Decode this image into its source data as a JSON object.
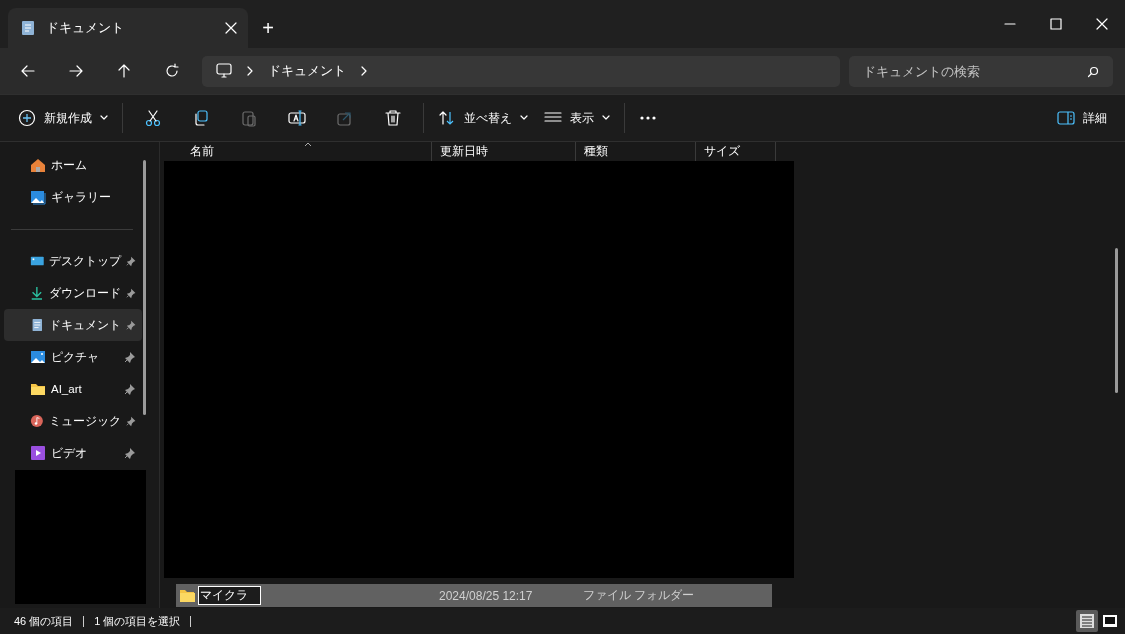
{
  "window": {
    "tabs": [
      {
        "title": "ドキュメント",
        "selected": true
      }
    ],
    "new_tab": "+"
  },
  "navigation": {
    "breadcrumb": [
      "ドキュメント"
    ],
    "search": {
      "placeholder": "ドキュメントの検索"
    }
  },
  "toolbar": {
    "new": "新規作成",
    "icon_buttons": [
      {
        "disabled": false
      },
      {
        "disabled": false
      },
      {
        "disabled": true
      },
      {
        "disabled": false
      },
      {
        "disabled": true
      },
      {
        "disabled": false
      }
    ],
    "sort": "並べ替え",
    "view": "表示",
    "details": "詳細"
  },
  "sidebar": {
    "top_items": [
      {
        "label": "ホーム",
        "selected": false
      },
      {
        "label": "ギャラリー",
        "selected": false
      }
    ],
    "pinned_items": [
      {
        "label": "デスクトップ",
        "selected": false
      },
      {
        "label": "ダウンロード",
        "selected": false
      },
      {
        "label": "ドキュメント",
        "selected": true
      },
      {
        "label": "ピクチャ",
        "selected": false
      },
      {
        "label": "AI_art",
        "selected": false
      },
      {
        "label": "ミュージック",
        "selected": false
      },
      {
        "label": "ビデオ",
        "selected": false
      }
    ]
  },
  "table": {
    "columns": [
      "名前",
      "更新日時",
      "種類",
      "サイズ"
    ],
    "rows": [
      {
        "name": "マイクラ",
        "modified": "2024/08/25 12:17",
        "type": "ファイル フォルダー",
        "selected": true,
        "renaming": true
      }
    ]
  },
  "status_bar": {
    "item_count": "46 個の項目",
    "selection": "1 個の項目を選択",
    "views": [
      {
        "selected": true
      },
      {
        "selected": false
      }
    ]
  }
}
